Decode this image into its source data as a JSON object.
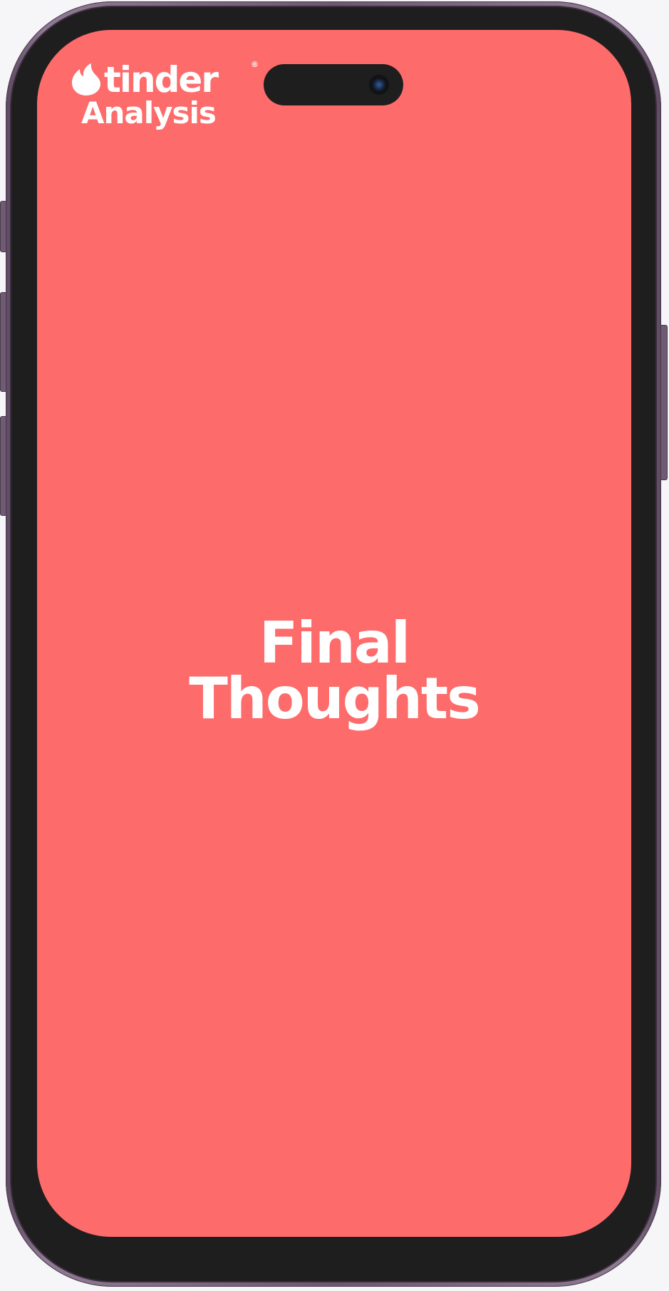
{
  "app": {
    "brand": "tinder",
    "brand_mark": "®",
    "subtitle": "Analysis"
  },
  "slide": {
    "title_line1": "Final",
    "title_line2": "Thoughts"
  },
  "colors": {
    "screen_background": "#fe6b6b",
    "text": "#ffffff",
    "phone_bezel": "#1f1e1e",
    "phone_frame": "#7a667d"
  },
  "icons": {
    "logo": "flame-icon",
    "camera": "camera-icon"
  }
}
